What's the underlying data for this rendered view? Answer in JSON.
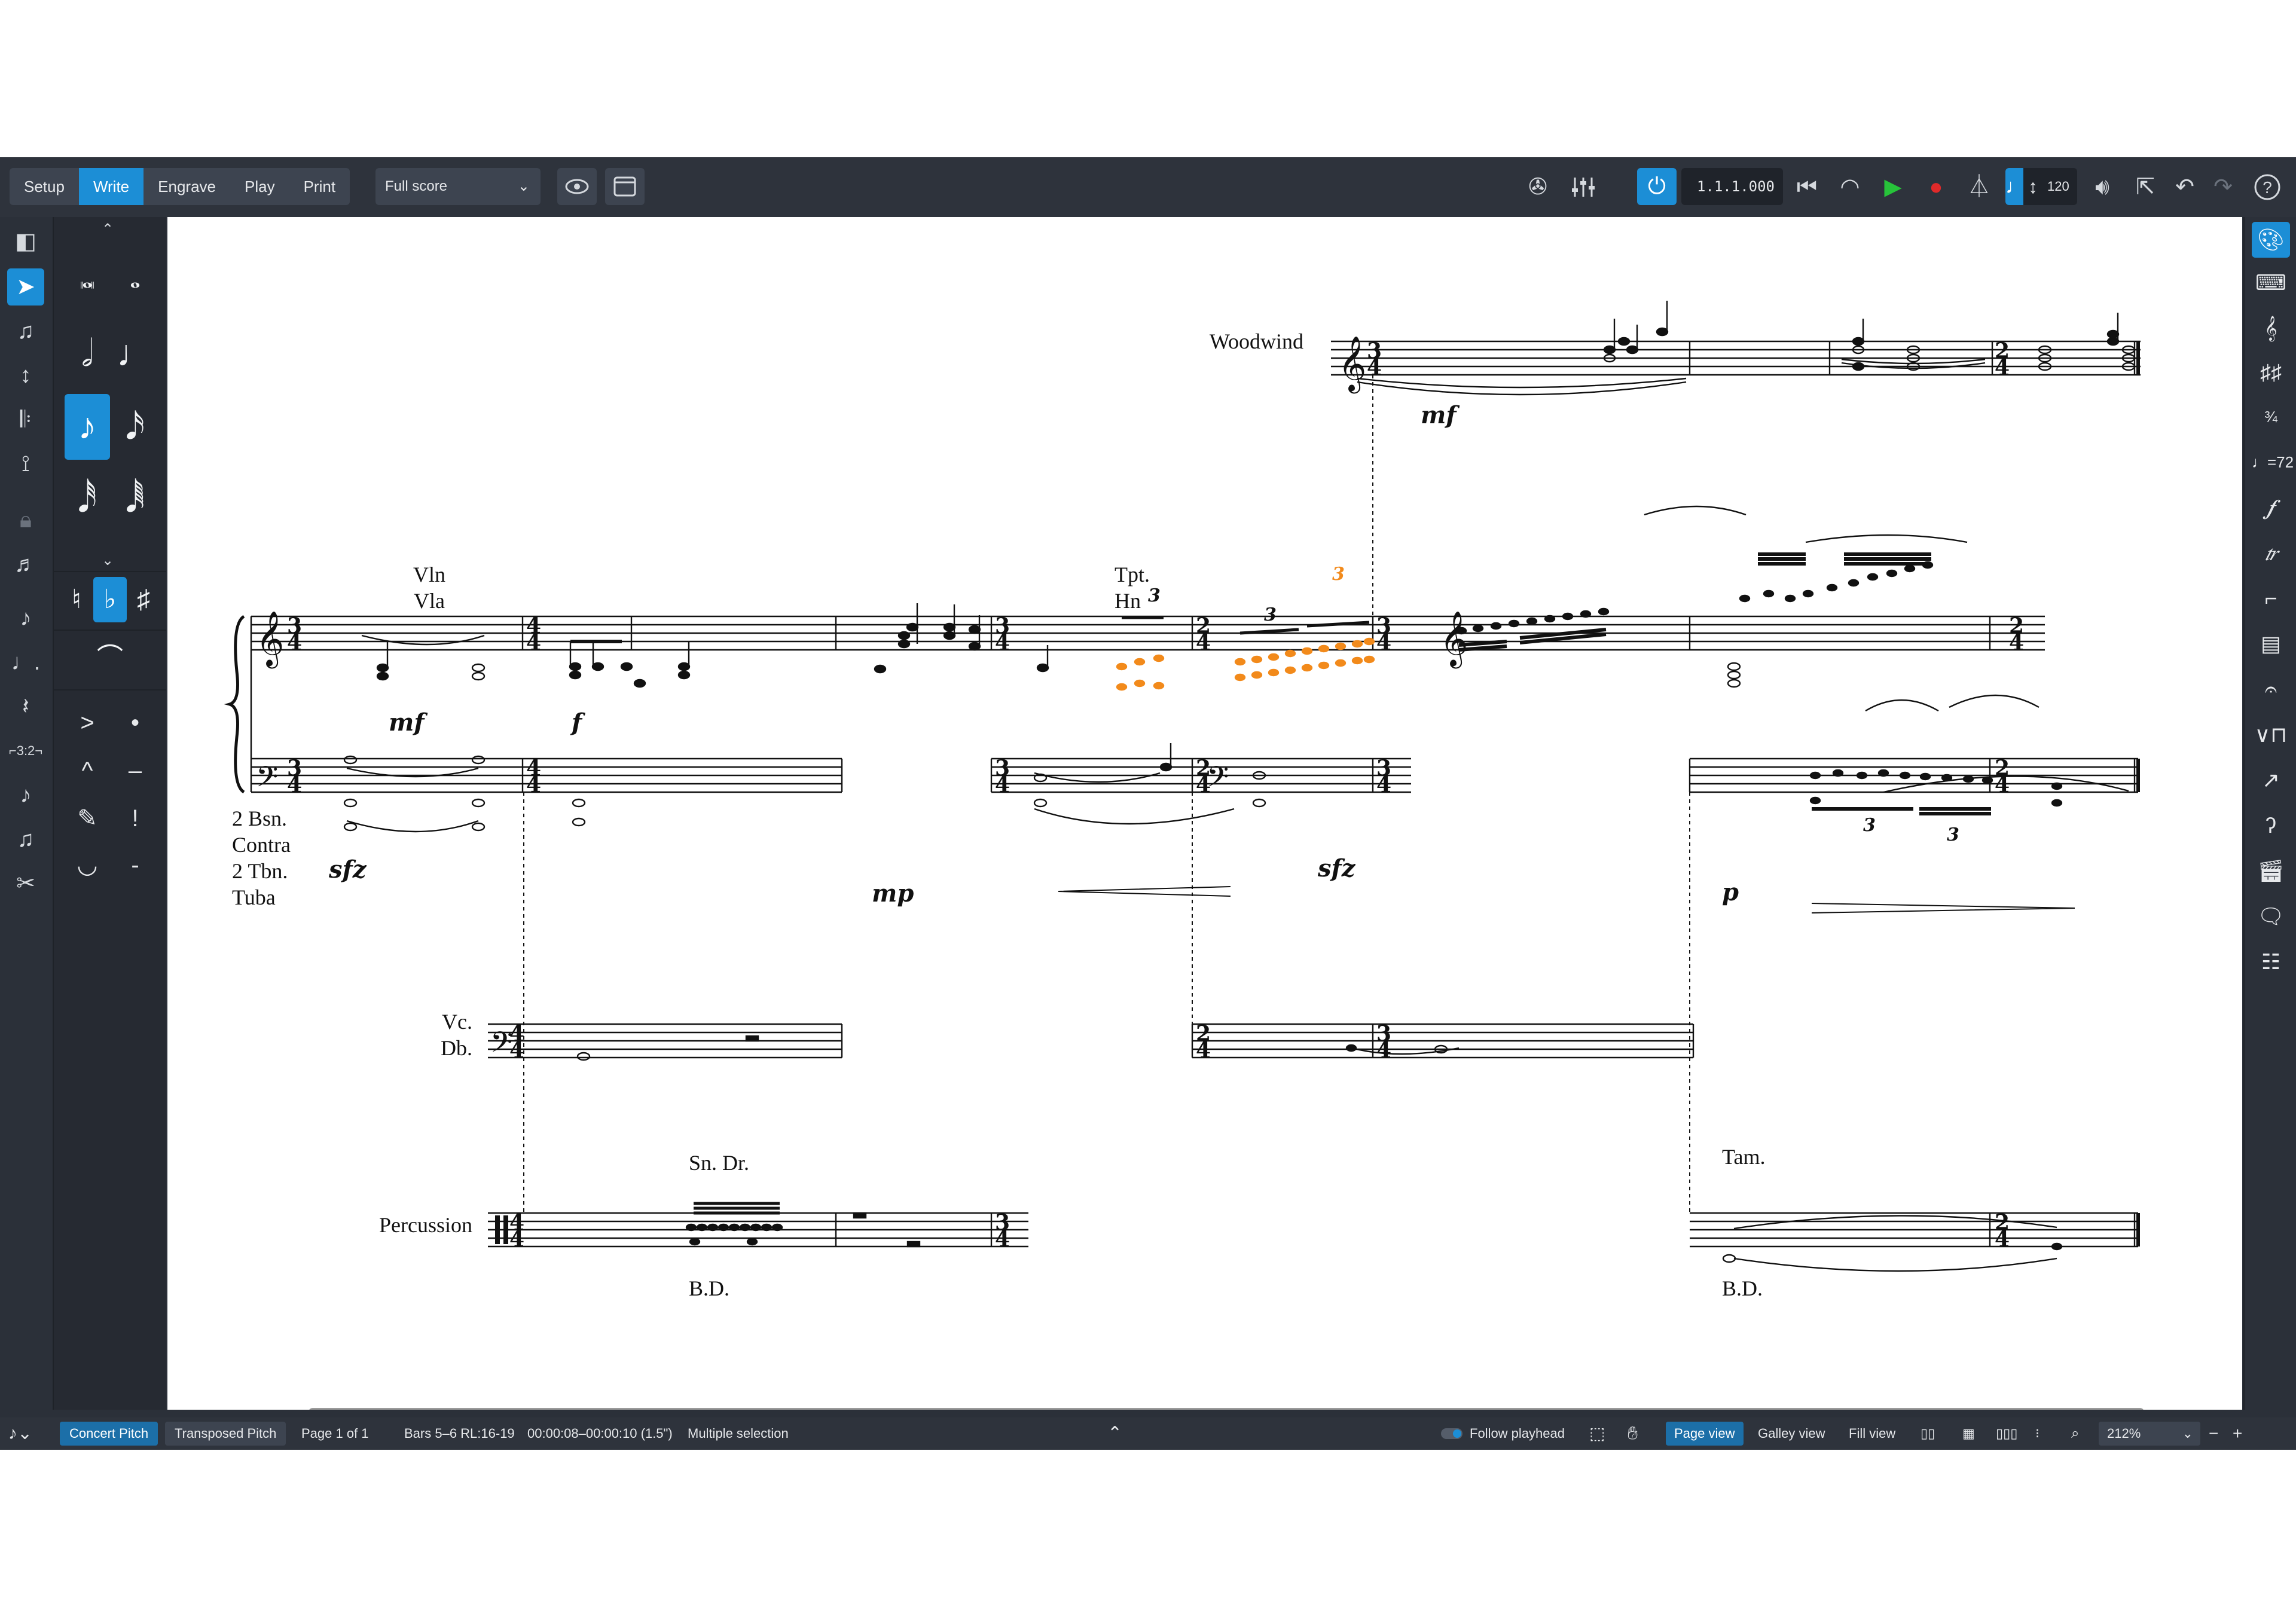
{
  "toolbar": {
    "modes": [
      "Setup",
      "Write",
      "Engrave",
      "Play",
      "Print"
    ],
    "active_mode": "Write",
    "layout": "Full score",
    "timecode": "1.1.1.000",
    "tempo": "120",
    "icons": [
      "eye-icon",
      "page-icon",
      "video-icon",
      "mixer-icon",
      "power-icon",
      "rewind-icon",
      "metronome-icon",
      "play-icon",
      "record-icon",
      "click-icon",
      "volume-icon",
      "export-icon",
      "undo-icon",
      "redo-icon",
      "help-icon"
    ]
  },
  "notes_panel": {
    "durations": [
      "breve",
      "whole",
      "half",
      "quarter",
      "eighth",
      "sixteenth",
      "thirty-second",
      "sixty-fourth"
    ],
    "active_duration": "eighth",
    "accidentals": [
      "♮",
      "♭",
      "♯"
    ],
    "active_accidental": "♭",
    "articulations": [
      ">",
      "·",
      "^",
      "–",
      "ꜛ",
      "!",
      "◡",
      "-"
    ]
  },
  "score": {
    "staves": {
      "woodwind": "Woodwind",
      "vln": "Vln",
      "vla": "Vla",
      "low_brass": [
        "2 Bsn.",
        "Contra",
        "2 Tbn.",
        "Tuba"
      ],
      "vc": "Vc.",
      "db": "Db.",
      "percussion": "Percussion"
    },
    "annotations": {
      "tpt": "Tpt.",
      "hn": "Hn",
      "sn_dr": "Sn. Dr.",
      "bd1": "B.D.",
      "tam": "Tam.",
      "bd2": "B.D."
    },
    "dynamics": {
      "ww_mf": "mf",
      "str_mf": "mf",
      "str_f": "f",
      "str_mp": "mp",
      "str_sfz": "sfz",
      "str_p": "p",
      "brass_sfz": "sfz"
    },
    "tuplets": [
      "3",
      "3",
      "3",
      "3",
      "3",
      "3"
    ]
  },
  "status": {
    "pitch_modes": [
      "Concert Pitch",
      "Transposed Pitch"
    ],
    "active_pitch_mode": "Concert Pitch",
    "page": "Page 1 of 1",
    "bars": "Bars 5–6 RL:16-19",
    "time": "00:00:08–00:00:10 (1.5\")",
    "selection": "Multiple selection",
    "follow_playhead": "Follow playhead",
    "views": [
      "Page view",
      "Galley view",
      "Fill view"
    ],
    "active_view": "Page view",
    "zoom": "212%"
  },
  "colors": {
    "accent": "#1c8ed6",
    "selected_notes": "#f28a1b",
    "panel": "#2b3039"
  }
}
